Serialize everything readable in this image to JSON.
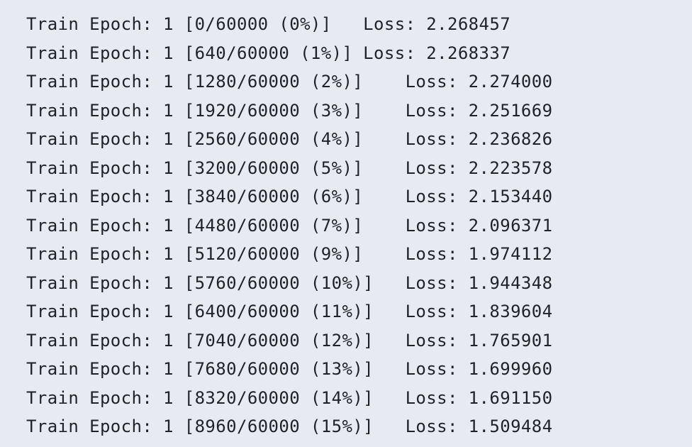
{
  "terminal_output": {
    "lines": [
      "Train Epoch: 1 [0/60000 (0%)]   Loss: 2.268457",
      "Train Epoch: 1 [640/60000 (1%)] Loss: 2.268337",
      "Train Epoch: 1 [1280/60000 (2%)]    Loss: 2.274000",
      "Train Epoch: 1 [1920/60000 (3%)]    Loss: 2.251669",
      "Train Epoch: 1 [2560/60000 (4%)]    Loss: 2.236826",
      "Train Epoch: 1 [3200/60000 (5%)]    Loss: 2.223578",
      "Train Epoch: 1 [3840/60000 (6%)]    Loss: 2.153440",
      "Train Epoch: 1 [4480/60000 (7%)]    Loss: 2.096371",
      "Train Epoch: 1 [5120/60000 (9%)]    Loss: 1.974112",
      "Train Epoch: 1 [5760/60000 (10%)]   Loss: 1.944348",
      "Train Epoch: 1 [6400/60000 (11%)]   Loss: 1.839604",
      "Train Epoch: 1 [7040/60000 (12%)]   Loss: 1.765901",
      "Train Epoch: 1 [7680/60000 (13%)]   Loss: 1.699960",
      "Train Epoch: 1 [8320/60000 (14%)]   Loss: 1.691150",
      "Train Epoch: 1 [8960/60000 (15%)]   Loss: 1.509484"
    ]
  }
}
